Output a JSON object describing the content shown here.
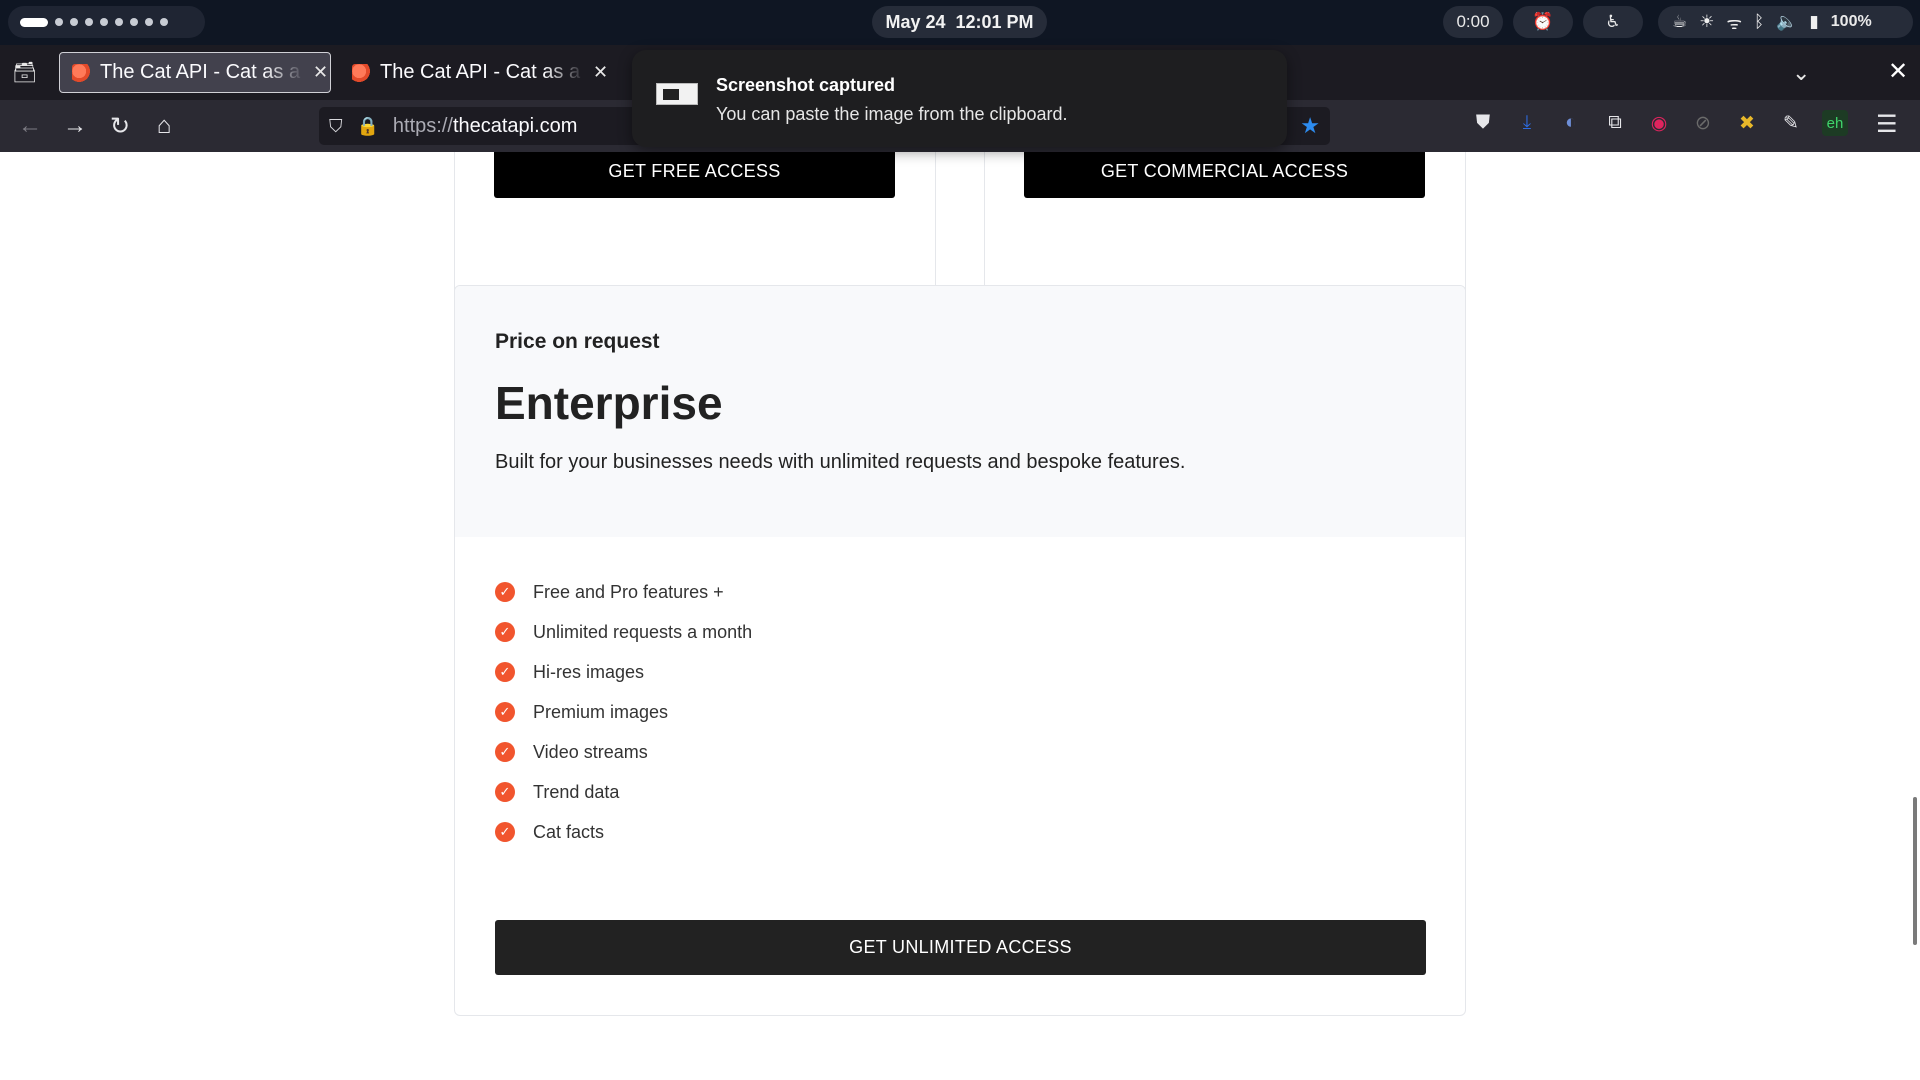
{
  "system_bar": {
    "date": "May 24",
    "time": "12:01 PM",
    "timer": "0:00",
    "battery": "100%",
    "icons": [
      "alarm-clock-icon",
      "accessibility-icon",
      "coffee-icon",
      "brightness-icon",
      "wifi-icon",
      "bluetooth-icon",
      "volume-icon",
      "battery-icon"
    ]
  },
  "browser": {
    "tabs": [
      {
        "title": "The Cat API - Cat as a Service"
      },
      {
        "title": "The Cat API - Cat as a Service"
      }
    ],
    "url_scheme": "https://",
    "url_host": "thecatapi.com"
  },
  "notification": {
    "title": "Screenshot captured",
    "body": "You can paste the image from the clipboard."
  },
  "page": {
    "top_buttons": {
      "free": "GET FREE ACCESS",
      "commercial": "GET COMMERCIAL ACCESS"
    },
    "enterprise": {
      "price_label": "Price on request",
      "name": "Enterprise",
      "description": "Built for your businesses needs with unlimited requests and bespoke features.",
      "features": [
        "Free and Pro features +",
        "Unlimited requests a month",
        "Hi-res images",
        "Premium images",
        "Video streams",
        "Trend data",
        "Cat facts"
      ],
      "cta": "GET UNLIMITED ACCESS"
    }
  },
  "colors": {
    "accent_check": "#f1552e",
    "cta_dark": "#222222",
    "header_bg": "#f8f9fb"
  }
}
